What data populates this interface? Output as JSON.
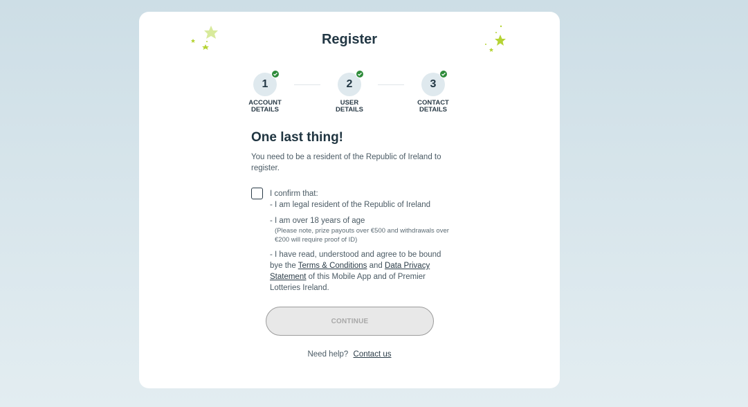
{
  "page": {
    "title": "Register"
  },
  "steps": [
    {
      "number": "1",
      "label_line1": "ACCOUNT",
      "label_line2": "DETAILS"
    },
    {
      "number": "2",
      "label_line1": "USER",
      "label_line2": "DETAILS"
    },
    {
      "number": "3",
      "label_line1": "CONTACT",
      "label_line2": "DETAILS"
    }
  ],
  "main": {
    "heading": "One last thing!",
    "intro": "You need to be a resident of the Republic of Ireland to register."
  },
  "confirm": {
    "lead": "I confirm that:",
    "item1": "- I am legal resident of the Republic of Ireland",
    "item2": "- I am over 18 years of age",
    "item2_note": "(Please note, prize payouts over €500 and withdrawals over €200 will require proof of ID)",
    "item3_prefix": "- I have read, understood and agree to be bound bye the ",
    "terms_link": "Terms & Conditions",
    "and": " and ",
    "privacy_link": "Data Privacy Statement",
    "item3_suffix": " of this Mobile App and of Premier Lotteries Ireland."
  },
  "actions": {
    "continue_label": "CONTINUE"
  },
  "help": {
    "prompt": "Need help?",
    "contact_link": "Contact us"
  },
  "colors": {
    "accent_green": "#2e8b3a",
    "star_green": "#b5d334",
    "heading": "#1f3440"
  }
}
